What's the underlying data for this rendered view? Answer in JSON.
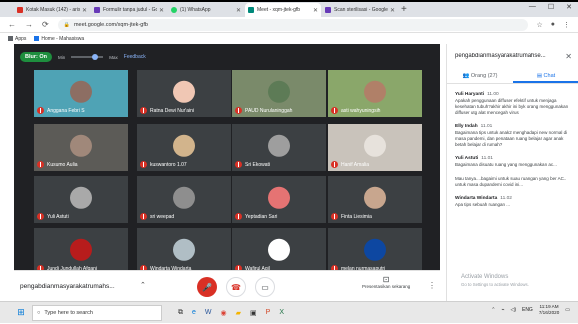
{
  "tabs": [
    {
      "label": "Kotak Masuk (142) - arisa@f",
      "color": "#d93025",
      "active": false
    },
    {
      "label": "Formulir tanpa judul - Googl",
      "color": "#673ab7",
      "active": false
    },
    {
      "label": "(1) WhatsApp",
      "color": "#25d366",
      "active": false
    },
    {
      "label": "Meet - xqm-jtek-gfb",
      "color": "#00897b",
      "active": true
    },
    {
      "label": "Scan sterilisasi - Google Form",
      "color": "#673ab7",
      "active": false
    }
  ],
  "address": {
    "url": "meet.google.com/xqm-jtek-gfb"
  },
  "bookmarks": {
    "apps": "Apps",
    "home": "Home - Mahasiswa"
  },
  "meet_controls": {
    "blur": "Blur: On",
    "min": "Min",
    "max": "Max",
    "feedback": "Feedback",
    "slider_level": 0.75
  },
  "participants": [
    {
      "name": "Anggana Febri S",
      "bg": "#4fa3b5",
      "face": "#8d6e63"
    },
    {
      "name": "Ratna Dewi Nur'aini",
      "bg": "#3c4043",
      "face": "#f0c7b4"
    },
    {
      "name": "PAUD Nurulaninggah",
      "bg": "#7a8a6a",
      "face": "#5d7b56"
    },
    {
      "name": "asti wahyuningsih",
      "bg": "#8aa76a",
      "face": "#b08068"
    },
    {
      "name": "Kusumo Aulia",
      "bg": "#5c5b57",
      "face": "#a0887a"
    },
    {
      "name": "kuswantoro 1.07",
      "bg": "#3c4043",
      "face": "#d2b48c"
    },
    {
      "name": "Sri Ekowati",
      "bg": "#3c4043",
      "face": "#9e9e9e"
    },
    {
      "name": "Hanif Amalia",
      "bg": "#c9c3bb",
      "face": "#e7e2dc"
    },
    {
      "name": "Yuli Astuti",
      "bg": "#3c4043",
      "face": "#a9a9a9"
    },
    {
      "name": "sri weepad",
      "bg": "#3c4043",
      "face": "#8e8e8e"
    },
    {
      "name": "Yeptadian Sari",
      "bg": "#3c4043",
      "face": "#e57373"
    },
    {
      "name": "Finta Liesimia",
      "bg": "#3c4043",
      "face": "#c8a68e"
    },
    {
      "name": "Jundi Jundullah Afgani",
      "bg": "#3c4043",
      "face": "#b71c1c"
    },
    {
      "name": "Windarta Windarta",
      "bg": "#3c4043",
      "face": "#b0bec5"
    },
    {
      "name": "Wafirul Aqil",
      "bg": "#3c4043",
      "face": "#ffffff"
    },
    {
      "name": "melan nurmasaputri",
      "bg": "#3c4043",
      "face": "#0d47a1"
    }
  ],
  "bottom": {
    "meeting_name": "pengabdianmasyarakatrumahs...",
    "present_label": "Presentasikan sekarang"
  },
  "panel": {
    "title": "pengabdianmasyarakatrumahse...",
    "people_tab": "Orang (27)",
    "chat_tab": "Chat",
    "messages": [
      {
        "sender": "Yuli Haryanti",
        "time": "11.00",
        "text": "Apakah penggunaan diffuser efektif untuk menjaga kesehatan tubuh?akhir akhir ini byk orang menggunakan diffuser utg alat mencegah virus"
      },
      {
        "sender": "Elly Indah",
        "time": "11.01",
        "text": "Bagaimana tips untuk anak2 menghadapi new normal di masa pandemi, dan penataan ruang belajar agar anak betah belajar di rumah?"
      },
      {
        "sender": "Yuli Astuti",
        "time": "11.01",
        "text": "Bagaimana disuatu ruang yang menggunakan ac..."
      },
      {
        "sender": "",
        "time": "",
        "text": "Mau tanya....bagaimi untuk suau ruangan yang ber AC.. untuk masa dupandemi covid ini..."
      },
      {
        "sender": "Windarta Windarta",
        "time": "11.02",
        "text": "Apa tips sebuah ruangan ..."
      }
    ],
    "activate_title": "Activate Windows",
    "activate_sub": "Go to Settings to activate Windows."
  },
  "taskbar": {
    "search": "Type here to search",
    "lang": "ENG",
    "time": "11:19 AM",
    "date": "7/16/2020"
  }
}
